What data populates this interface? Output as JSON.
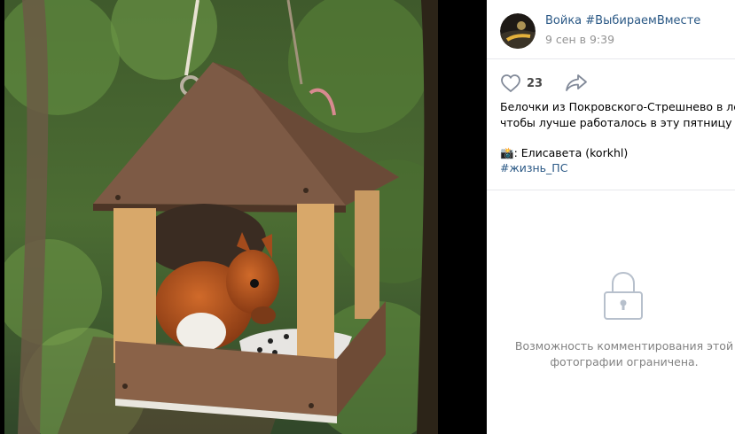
{
  "post": {
    "author": "Войка #ВыбираемВместе",
    "date": "9 сен в 9:39",
    "likes_count": "23",
    "text_lines": [
      "Белочки из Покровского-Стрешнево в лент",
      "чтобы лучше работалось в эту пятницу 😏"
    ],
    "credit": "📸: Елисавета (korkhl)",
    "hashtag": "#жизнь_ПС"
  },
  "comments": {
    "restricted_line1": "Возможность комментирования этой",
    "restricted_line2": "фотографии ограничена."
  },
  "icons": {
    "like": "heart-icon",
    "share": "share-arrow-icon",
    "lock": "lock-icon"
  },
  "colors": {
    "link": "#2a5885",
    "muted": "#939393",
    "icon": "#828a99",
    "lock": "#b7c0cc"
  }
}
